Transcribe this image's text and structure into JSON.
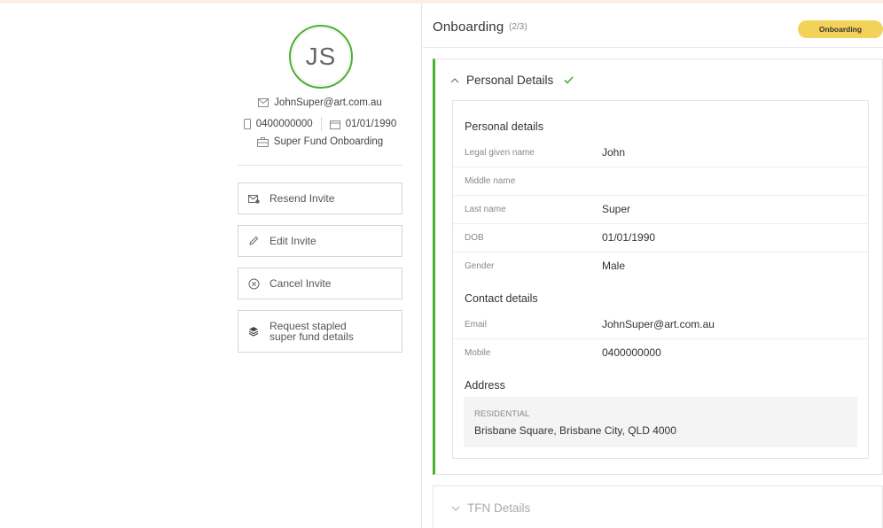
{
  "profile": {
    "initials": "JS",
    "email": "JohnSuper@art.com.au",
    "phone": "0400000000",
    "dob": "01/01/1990",
    "workflow": "Super Fund Onboarding",
    "ring_color": "#4caf32"
  },
  "actions": [
    {
      "label": "Resend Invite",
      "icon": "envelope-gear-icon"
    },
    {
      "label": "Edit Invite",
      "icon": "pencil-icon"
    },
    {
      "label": "Cancel Invite",
      "icon": "circle-x-icon"
    },
    {
      "label_line1": "Request stapled",
      "label_line2": "super fund details",
      "icon": "layers-icon"
    }
  ],
  "header": {
    "title": "Onboarding",
    "count": "(2/3)",
    "badge": "Onboarding",
    "badge_color": "#f3d25a"
  },
  "personal_section": {
    "title": "Personal Details",
    "status_icon": "check-icon",
    "accent_color": "#4caf32",
    "personal_heading": "Personal details",
    "personal_rows": [
      {
        "key": "Legal given name",
        "value": "John"
      },
      {
        "key": "Middle name",
        "value": ""
      },
      {
        "key": "Last name",
        "value": "Super"
      },
      {
        "key": "DOB",
        "value": "01/01/1990"
      },
      {
        "key": "Gender",
        "value": "Male"
      }
    ],
    "contact_heading": "Contact details",
    "contact_rows": [
      {
        "key": "Email",
        "value": "JohnSuper@art.com.au"
      },
      {
        "key": "Mobile",
        "value": "0400000000"
      }
    ],
    "address_heading": "Address",
    "address_type": "RESIDENTIAL",
    "address_value": "Brisbane Square, Brisbane City, QLD 4000"
  },
  "tfn_section": {
    "title": "TFN Details"
  }
}
